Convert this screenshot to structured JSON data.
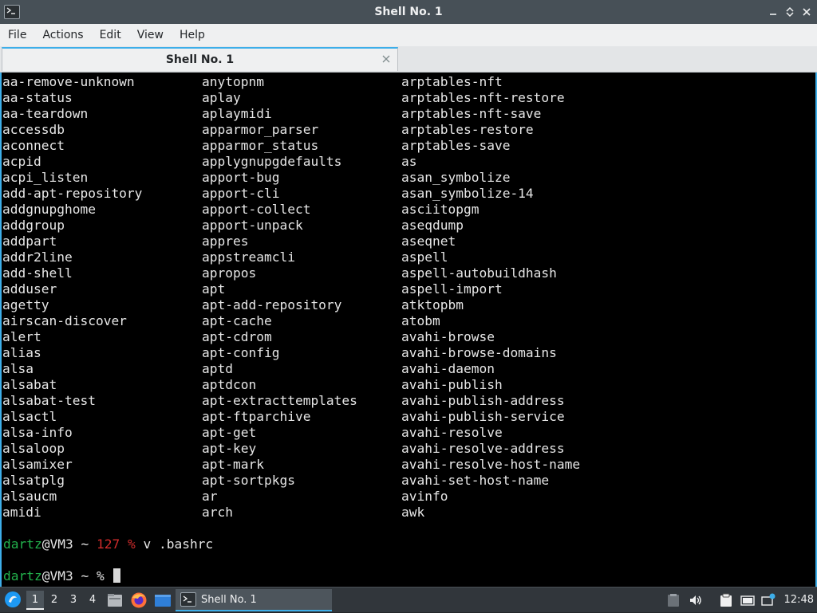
{
  "window": {
    "title": "Shell No. 1"
  },
  "menubar": {
    "items": [
      "File",
      "Actions",
      "Edit",
      "View",
      "Help"
    ]
  },
  "tabs": [
    {
      "label": "Shell No. 1"
    }
  ],
  "terminal": {
    "listing_columns": [
      [
        "aa-remove-unknown",
        "aa-status",
        "aa-teardown",
        "accessdb",
        "aconnect",
        "acpid",
        "acpi_listen",
        "add-apt-repository",
        "addgnupghome",
        "addgroup",
        "addpart",
        "addr2line",
        "add-shell",
        "adduser",
        "agetty",
        "airscan-discover",
        "alert",
        "alias",
        "alsa",
        "alsabat",
        "alsabat-test",
        "alsactl",
        "alsa-info",
        "alsaloop",
        "alsamixer",
        "alsatplg",
        "alsaucm",
        "amidi"
      ],
      [
        "anytopnm",
        "aplay",
        "aplaymidi",
        "apparmor_parser",
        "apparmor_status",
        "applygnupgdefaults",
        "apport-bug",
        "apport-cli",
        "apport-collect",
        "apport-unpack",
        "appres",
        "appstreamcli",
        "apropos",
        "apt",
        "apt-add-repository",
        "apt-cache",
        "apt-cdrom",
        "apt-config",
        "aptd",
        "aptdcon",
        "apt-extracttemplates",
        "apt-ftparchive",
        "apt-get",
        "apt-key",
        "apt-mark",
        "apt-sortpkgs",
        "ar",
        "arch"
      ],
      [
        "arptables-nft",
        "arptables-nft-restore",
        "arptables-nft-save",
        "arptables-restore",
        "arptables-save",
        "as",
        "asan_symbolize",
        "asan_symbolize-14",
        "asciitopgm",
        "aseqdump",
        "aseqnet",
        "aspell",
        "aspell-autobuildhash",
        "aspell-import",
        "atktopbm",
        "atobm",
        "avahi-browse",
        "avahi-browse-domains",
        "avahi-daemon",
        "avahi-publish",
        "avahi-publish-address",
        "avahi-publish-service",
        "avahi-resolve",
        "avahi-resolve-address",
        "avahi-resolve-host-name",
        "avahi-set-host-name",
        "avinfo",
        "awk"
      ]
    ],
    "prompt1": {
      "user": "dartz",
      "host": "@VM3 ~ ",
      "exit_code": "127",
      "symbol": " %",
      "command": " v .bashrc"
    },
    "prompt2": {
      "user": "dartz",
      "host": "@VM3 ~ ",
      "symbol": "% "
    }
  },
  "taskbar": {
    "workspaces": [
      "1",
      "2",
      "3",
      "4"
    ],
    "active_workspace": "1",
    "launchers": [
      "file-manager-icon",
      "firefox-icon",
      "desktop-icon"
    ],
    "task": {
      "label": "Shell No. 1"
    },
    "tray": [
      "clipboard-icon",
      "volume-icon",
      "notes-icon",
      "battery-icon",
      "network-icon"
    ],
    "clock": "12:48"
  },
  "colors": {
    "accent": "#3daee9",
    "titlebar": "#475057",
    "prompt_user": "#22b14c",
    "prompt_error": "#d02b2b",
    "terminal_bg": "#000000"
  }
}
